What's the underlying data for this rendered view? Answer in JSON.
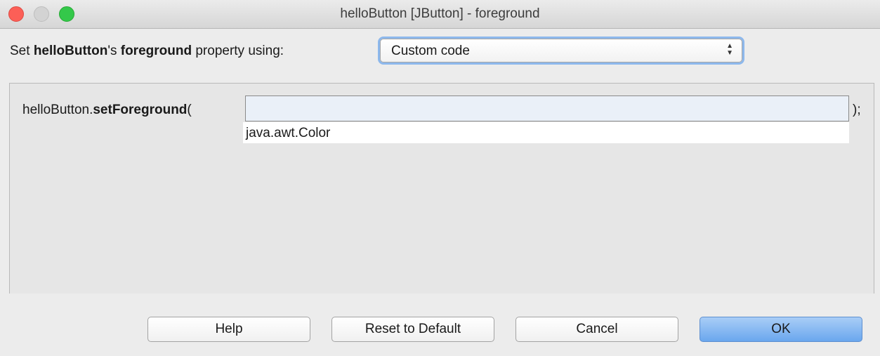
{
  "window": {
    "title": "helloButton [JButton] - foreground"
  },
  "property_line": {
    "prefix": "Set ",
    "component": "helloButton",
    "possessive": "'s ",
    "property": "foreground",
    "suffix": " property using:"
  },
  "mode_select": {
    "value": "Custom code"
  },
  "code": {
    "object": "helloButton.",
    "method": "setForeground",
    "open_paren": "(",
    "input_value": "",
    "close": ");",
    "type_hint": "java.awt.Color"
  },
  "buttons": {
    "help": "Help",
    "reset": "Reset to Default",
    "cancel": "Cancel",
    "ok": "OK"
  },
  "colors": {
    "close": "#fc5f57",
    "minimize": "#d3d3d3",
    "zoom": "#34c84a",
    "focus_ring": "#8db8ec",
    "primary_button": "#6aa7ee"
  }
}
